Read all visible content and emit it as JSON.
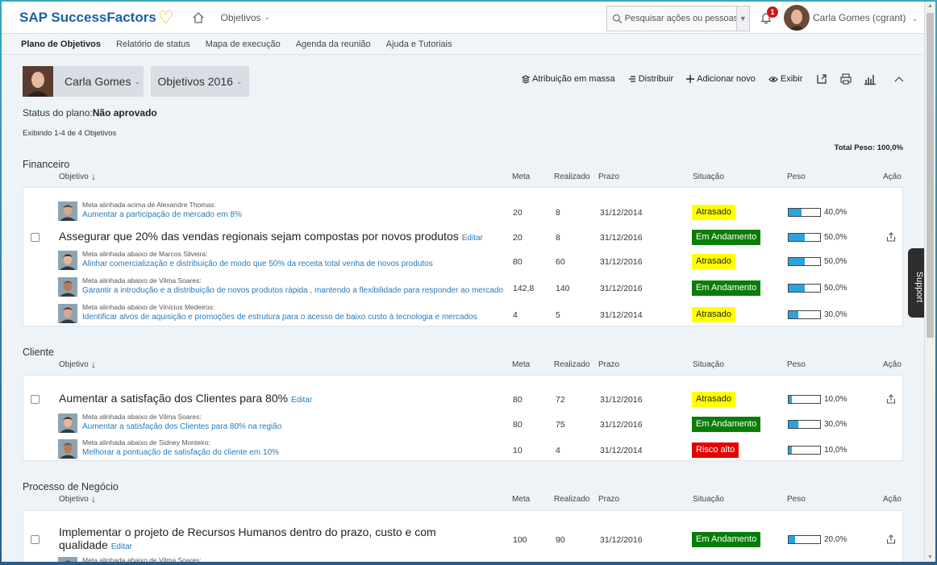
{
  "app": {
    "brand": "SAP SuccessFactors",
    "module": "Objetivos"
  },
  "search": {
    "placeholder": "Pesquisar ações ou pessoas"
  },
  "notifications": {
    "count": "1"
  },
  "user": {
    "name": "Carla Gomes (cgrant)"
  },
  "subnav": [
    "Plano de Objetivos",
    "Relatório de status",
    "Mapa de execução",
    "Agenda da reunião",
    "Ajuda e Tutoriais"
  ],
  "header": {
    "person": "Carla Gomes",
    "plan": "Objetivos 2016",
    "toolbar": {
      "mass": "Atribuição em massa",
      "distribute": "Distribuir",
      "add": "Adicionar novo",
      "view": "Exibir"
    }
  },
  "plan_status": {
    "label": "Status do plano:",
    "value": "Não aprovado"
  },
  "showing": "Exibindo 1-4 de 4 Objetivos",
  "total_weight": "Total Peso: 100,0%",
  "columns": {
    "objective": "Objetivo",
    "target": "Meta",
    "actual": "Realizado",
    "due": "Prazo",
    "status": "Situação",
    "weight": "Peso",
    "action": "Ação"
  },
  "edit_label": "Editar",
  "sections": [
    {
      "name": "Financeiro",
      "rows": [
        {
          "kind": "aligned",
          "label": "Meta alinhada acima de Alexandre Thomas:",
          "link": "Aumentar a participação de mercado em 8%",
          "meta": "20",
          "real": "8",
          "due": "31/12/2014",
          "status": "Atrasado",
          "status_type": "late",
          "weight": "40,0%",
          "fill": 0.4
        },
        {
          "kind": "main",
          "title": "Assegurar que 20% das vendas regionais sejam compostas por novos produtos",
          "meta": "20",
          "real": "8",
          "due": "31/12/2016",
          "status": "Em Andamento",
          "status_type": "prog",
          "weight": "50,0%",
          "fill": 0.5
        },
        {
          "kind": "aligned",
          "label": "Meta alinhada abaixo de Marcos Silveira:",
          "link": "Alinhar comercialização e distribuição de modo que 50% da receita total venha de novos produtos",
          "meta": "80",
          "real": "60",
          "due": "31/12/2016",
          "status": "Atrasado",
          "status_type": "late",
          "weight": "50,0%",
          "fill": 0.5
        },
        {
          "kind": "aligned",
          "label": "Meta alinhada abaixo de Vilma Soares:",
          "link": "Garantir a introdução e a distribuição de novos produtos rápida , mantendo a flexibilidade para responder ao mercado",
          "meta": "142,8",
          "real": "140",
          "due": "31/12/2016",
          "status": "Em Andamento",
          "status_type": "prog",
          "weight": "50,0%",
          "fill": 0.5
        },
        {
          "kind": "aligned",
          "label": "Meta alinhada abaixo de Vinícius Medeiros:",
          "link": "Identificar alvos de aquisição e promoções de estrutura para o acesso de baixo custo à tecnologia e mercados",
          "meta": "4",
          "real": "5",
          "due": "31/12/2014",
          "status": "Atrasado",
          "status_type": "late",
          "weight": "30,0%",
          "fill": 0.3
        }
      ]
    },
    {
      "name": "Cliente",
      "rows": [
        {
          "kind": "main",
          "title": "Aumentar a satisfação dos Clientes para 80%",
          "meta": "80",
          "real": "72",
          "due": "31/12/2016",
          "status": "Atrasado",
          "status_type": "late",
          "weight": "10,0%",
          "fill": 0.1
        },
        {
          "kind": "aligned",
          "label": "Meta alinhada abaixo de Vilma Soares:",
          "link": "Aumentar a satisfação dos Clientes para 80% na região",
          "meta": "80",
          "real": "75",
          "due": "31/12/2016",
          "status": "Em Andamento",
          "status_type": "prog",
          "weight": "30,0%",
          "fill": 0.3
        },
        {
          "kind": "aligned",
          "label": "Meta alinhada abaixo de Sidney Monteiro:",
          "link": "Melhorar a pontuação de satisfação do cliente em 10%",
          "meta": "10",
          "real": "4",
          "due": "31/12/2014",
          "status": "Risco alto",
          "status_type": "risk",
          "weight": "10,0%",
          "fill": 0.1
        }
      ]
    },
    {
      "name": "Processo de Negócio",
      "rows": [
        {
          "kind": "main",
          "title": "Implementar o projeto de Recursos Humanos dentro do prazo, custo e com",
          "title2": "qualidade",
          "meta": "100",
          "real": "90",
          "due": "31/12/2016",
          "status": "Em Andamento",
          "status_type": "prog",
          "weight": "20,0%",
          "fill": 0.2
        },
        {
          "kind": "aligned",
          "label": "Meta alinhada abaixo de Vilma Soares:",
          "link": "",
          "meta": "",
          "real": "",
          "due": "",
          "status": "",
          "status_type": "",
          "weight": "",
          "fill": 0
        }
      ]
    }
  ],
  "support": "Support"
}
